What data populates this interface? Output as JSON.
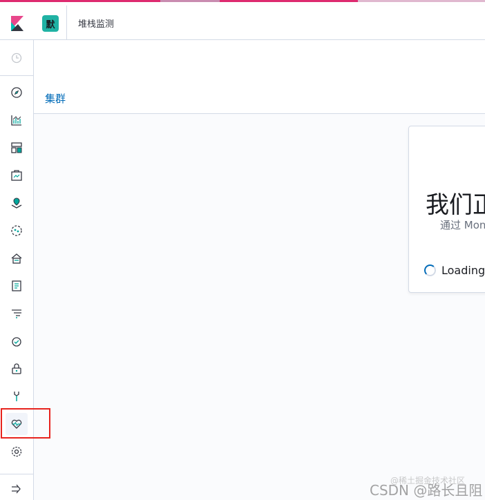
{
  "browser": {
    "tab_colors": [
      "#d9a63b",
      "#de2a6f",
      "#ee2a2a",
      "#e26a1f"
    ]
  },
  "header": {
    "space_avatar_letter": "默",
    "breadcrumb": "堆栈监测"
  },
  "nav": {
    "items": [
      {
        "name": "recently-viewed-icon"
      },
      {
        "name": "discover-icon"
      },
      {
        "name": "visualize-icon"
      },
      {
        "name": "dashboard-icon"
      },
      {
        "name": "canvas-icon"
      },
      {
        "name": "maps-icon"
      },
      {
        "name": "machine-learning-icon"
      },
      {
        "name": "infrastructure-icon"
      },
      {
        "name": "logs-icon"
      },
      {
        "name": "apm-icon"
      },
      {
        "name": "uptime-icon"
      },
      {
        "name": "siem-icon"
      },
      {
        "name": "dev-tools-icon"
      },
      {
        "name": "stack-monitoring-icon"
      },
      {
        "name": "management-icon"
      },
      {
        "name": "collapse-nav-icon"
      }
    ]
  },
  "page": {
    "section_title": "集群"
  },
  "card": {
    "title": "我们正",
    "subtitle": "通过 Mon",
    "loading_text": "Loading,"
  },
  "watermark": {
    "main": "CSDN @路长且阻",
    "secondary": "@稀土掘金技术社区"
  },
  "colors": {
    "accent": "#006bb8",
    "avatar": "#20b2a4",
    "highlight": "#e7221d"
  }
}
